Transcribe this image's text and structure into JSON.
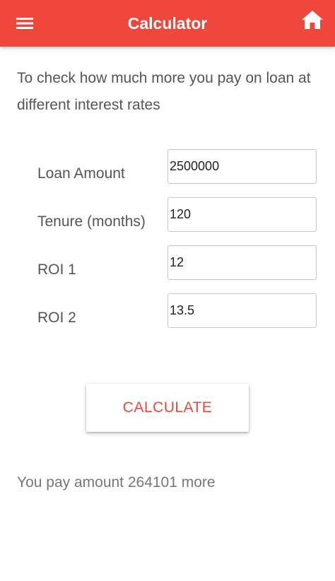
{
  "toolbar": {
    "title": "Calculator",
    "menu_icon": "hamburger-menu-icon",
    "home_icon": "home-icon",
    "color": "#f0473c"
  },
  "intro": {
    "text": "To check how much more you pay on loan at different interest rates"
  },
  "form": {
    "loan_amount": {
      "label": "Loan Amount",
      "value": "2500000"
    },
    "tenure": {
      "label": "Tenure (months)",
      "value": "120"
    },
    "roi1": {
      "label": "ROI 1",
      "value": "12"
    },
    "roi2": {
      "label": "ROI 2",
      "value": "13.5"
    }
  },
  "calculate_button": {
    "label": "CALCULATE"
  },
  "result": {
    "text": "You pay amount 264101 more"
  }
}
